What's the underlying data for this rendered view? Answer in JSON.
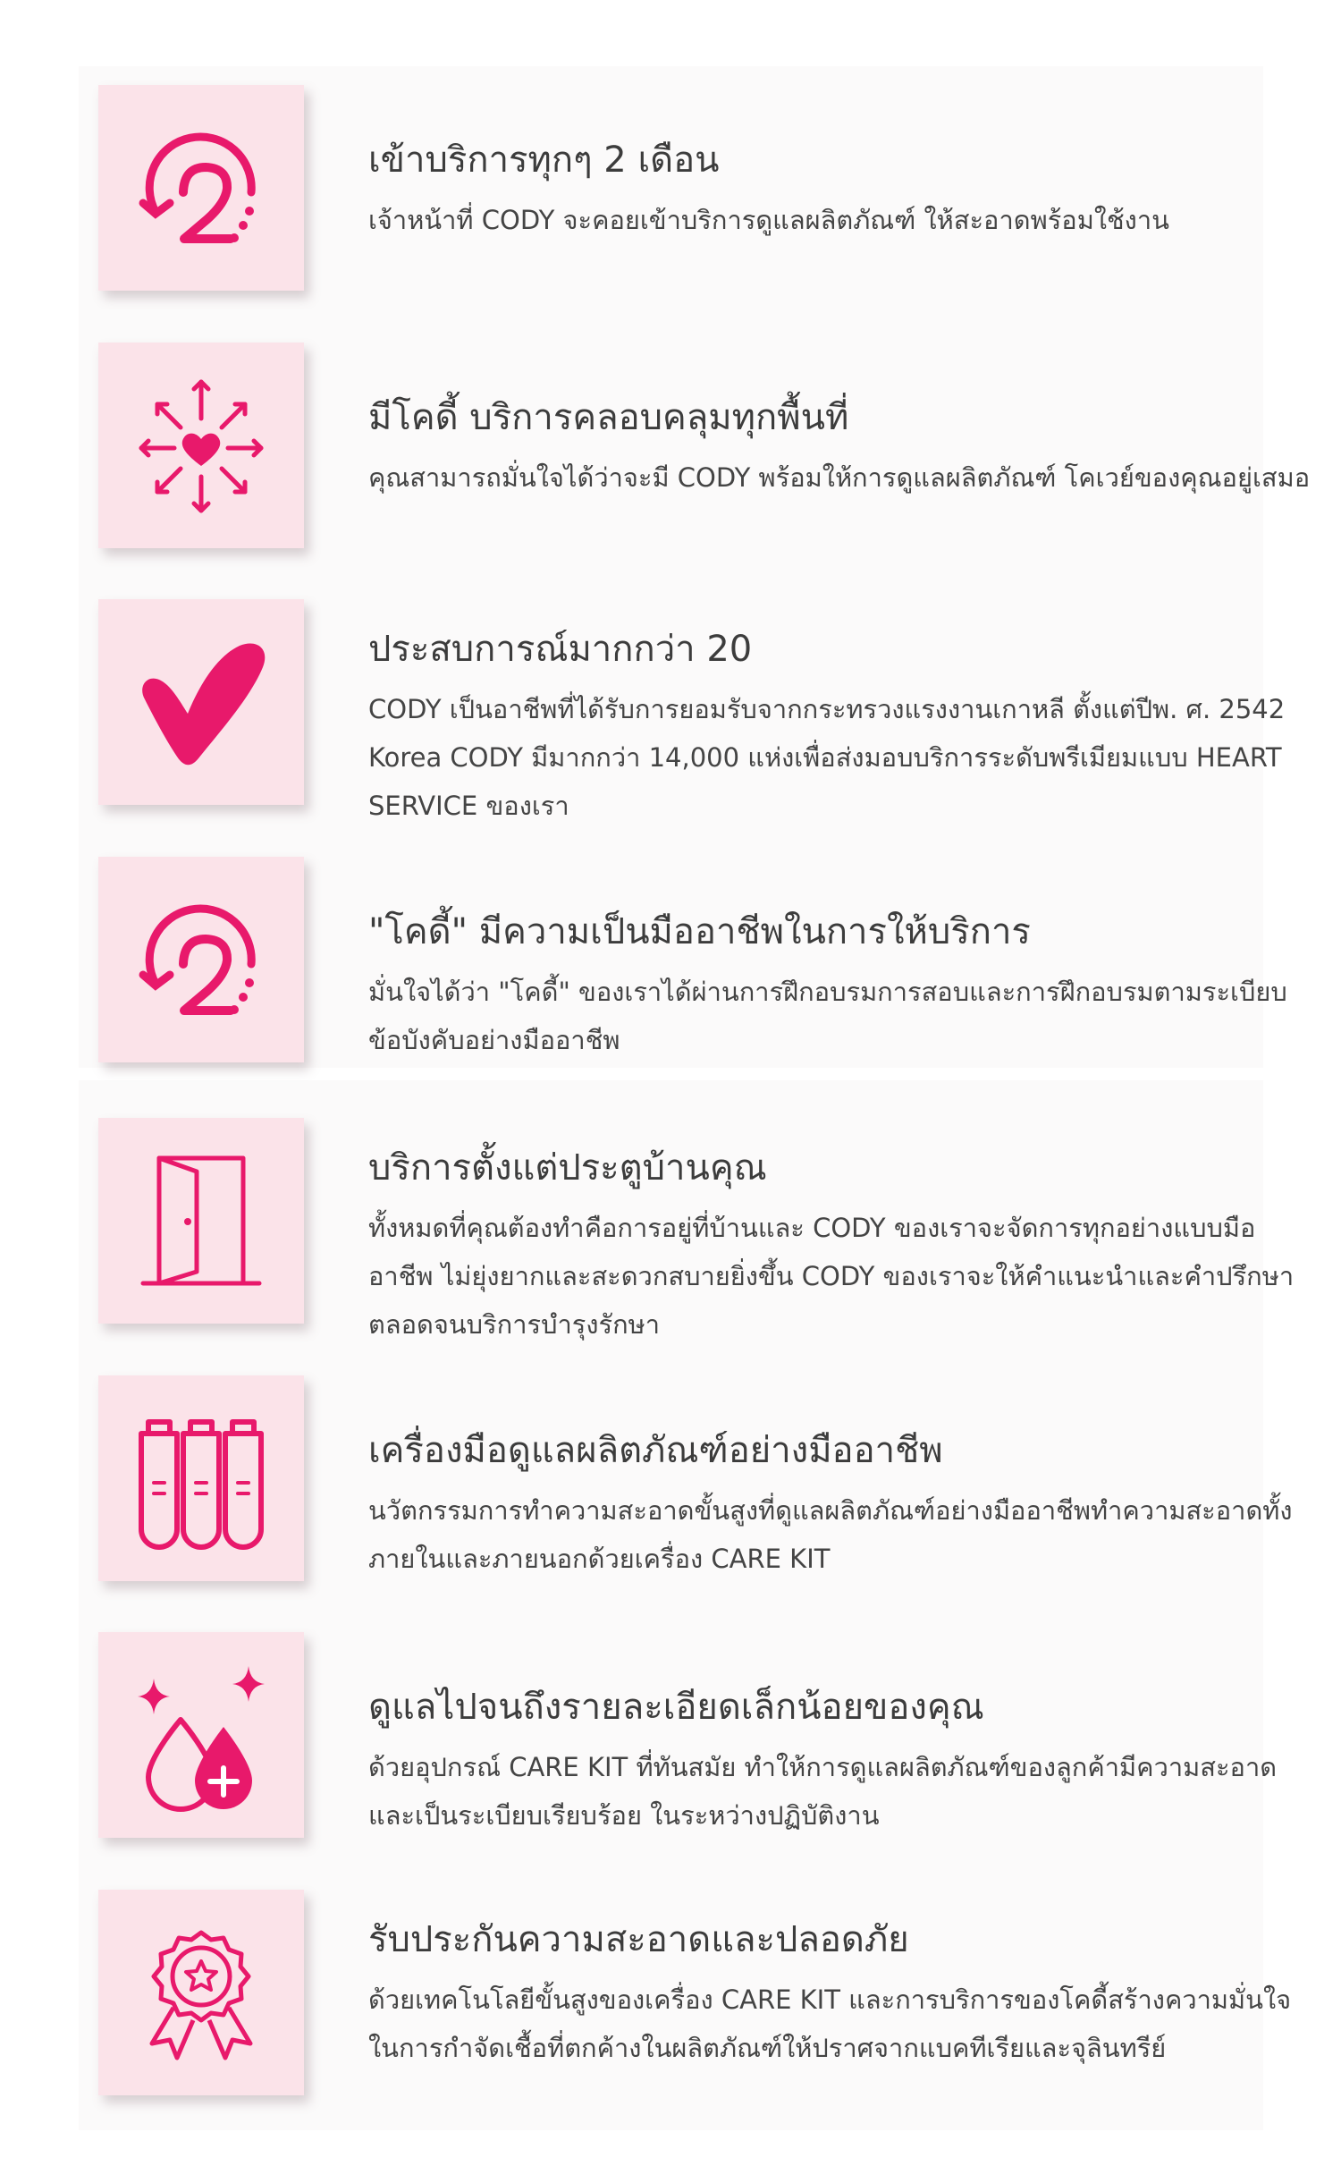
{
  "accent_color": "#e8196b",
  "features": [
    {
      "icon": "rotate-two-icon",
      "title": "เข้าบริการทุกๆ 2 เดือน",
      "description": "เจ้าหน้าที่ CODY จะคอยเข้าบริการดูแลผลิตภัณฑ์ ให้สะอาดพร้อมใช้งาน"
    },
    {
      "icon": "heart-arrows-icon",
      "title": "มีโคดี้ บริการคลอบคลุมทุกพื้นที่",
      "description": "คุณสามารถมั่นใจได้ว่าจะมี CODY พร้อมให้การดูแลผลิตภัณฑ์ โคเวย์ของคุณอยู่เสมอ"
    },
    {
      "icon": "checkmark-icon",
      "title": "ประสบการณ์มากกว่า 20",
      "description": "CODY เป็นอาชีพที่ได้รับการยอมรับจากกระทรวงแรงงานเกาหลี ตั้งแต่ปีพ. ศ. 2542 Korea CODY มีมากกว่า 14,000 แห่งเพื่อส่งมอบบริการระดับพรีเมียมแบบ HEART SERVICE ของเรา"
    },
    {
      "icon": "rotate-two-icon",
      "title": "\"โคดี้\" มีความเป็นมืออาชีพในการให้บริการ",
      "description": "มั่นใจได้ว่า \"โคดี้\" ของเราได้ผ่านการฝึกอบรมการสอบและการฝึกอบรมตามระเบียบข้อบังคับอย่างมืออาชีพ"
    },
    {
      "icon": "door-icon",
      "title": "บริการตั้งแต่ประตูบ้านคุณ",
      "description": "ทั้งหมดที่คุณต้องทำคือการอยู่ที่บ้านและ CODY ของเราจะจัดการทุกอย่างแบบมืออาชีพ ไม่ยุ่งยากและสะดวกสบายยิ่งขึ้น CODY ของเราจะให้คำแนะนำและคำปรึกษาตลอดจนบริการบำรุงรักษา"
    },
    {
      "icon": "test-tubes-icon",
      "title": "เครื่องมือดูแลผลิตภัณฑ์อย่างมืออาชีพ",
      "description": "นวัตกรรมการทำความสะอาดขั้นสูงที่ดูแลผลิตภัณฑ์อย่างมืออาชีพทำความสะอาดทั้งภายในและภายนอกด้วยเครื่อง CARE KIT"
    },
    {
      "icon": "sparkle-drops-icon",
      "title": "ดูแลไปจนถึงรายละเอียดเล็กน้อยของคุณ",
      "description": "ด้วยอุปกรณ์ CARE KIT ที่ทันสมัย ทำให้การดูแลผลิตภัณฑ์ของลูกค้ามีความสะอาดและเป็นระเบียบเรียบร้อย ในระหว่างปฏิบัติงาน"
    },
    {
      "icon": "award-badge-icon",
      "title": "รับประกันความสะอาดและปลอดภัย",
      "description": "ด้วยเทคโนโลยีขั้นสูงของเครื่อง CARE KIT และการบริการของโคดี้สร้างความมั่นใจในการกำจัดเชื้อที่ตกค้างในผลิตภัณฑ์ให้ปราศจากแบคทีเรียและจุลินทรีย์"
    }
  ]
}
